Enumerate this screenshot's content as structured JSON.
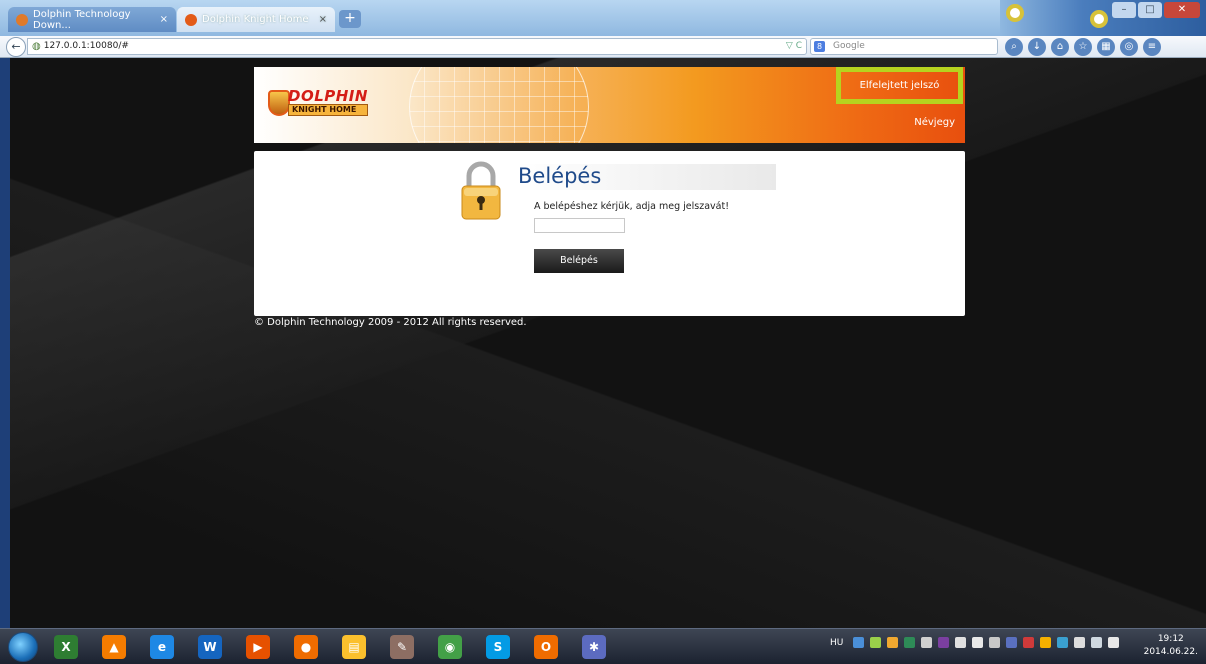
{
  "browser": {
    "tabs": [
      {
        "label": "Dolphin Technology Down...",
        "close": "×"
      },
      {
        "label": "Dolphin Knight Home",
        "close": "×"
      }
    ],
    "new_tab": "+",
    "address": "127.0.0.1:10080/#",
    "address_controls": "▽ C",
    "search_placeholder": "Google",
    "search_engine": "8",
    "back": "←",
    "window_buttons": {
      "minimize": "–",
      "maximize": "□",
      "close": "✕"
    }
  },
  "header": {
    "logo_line1": "DOLPHIN",
    "logo_line2": "KNIGHT HOME",
    "forgot_password": "Elfelejtett jelszó",
    "about": "Névjegy"
  },
  "login": {
    "title": "Belépés",
    "prompt": "A belépéshez kérjük, adja meg jelszavát!",
    "password_value": "",
    "button": "Belépés"
  },
  "footer": {
    "copyright": "© Dolphin Technology 2009 - 2012 All rights reserved."
  },
  "taskbar": {
    "apps": [
      {
        "name": "excel-icon",
        "glyph": "X",
        "color": "#2e7d32"
      },
      {
        "name": "vlc-icon",
        "glyph": "▲",
        "color": "#f57c00"
      },
      {
        "name": "internet-explorer-icon",
        "glyph": "e",
        "color": "#1e88e5"
      },
      {
        "name": "word-icon",
        "glyph": "W",
        "color": "#1565c0"
      },
      {
        "name": "media-player-icon",
        "glyph": "▶",
        "color": "#e65100"
      },
      {
        "name": "firefox-icon",
        "glyph": "●",
        "color": "#ef6c00"
      },
      {
        "name": "file-explorer-icon",
        "glyph": "▤",
        "color": "#fbc02d"
      },
      {
        "name": "paint-icon",
        "glyph": "✎",
        "color": "#8d6e63"
      },
      {
        "name": "chrome-icon",
        "glyph": "◉",
        "color": "#43a047"
      },
      {
        "name": "skype-icon",
        "glyph": "S",
        "color": "#039be5"
      },
      {
        "name": "outlook-icon",
        "glyph": "O",
        "color": "#ef6c00"
      },
      {
        "name": "paint-palette-icon",
        "glyph": "✱",
        "color": "#5c6bc0"
      }
    ],
    "language": "HU",
    "time": "19:12",
    "date": "2014.06.22."
  },
  "colors": {
    "header_accent": "#ef6a14",
    "highlight_box": "#b6d31f",
    "title_blue": "#1f4a8a"
  }
}
